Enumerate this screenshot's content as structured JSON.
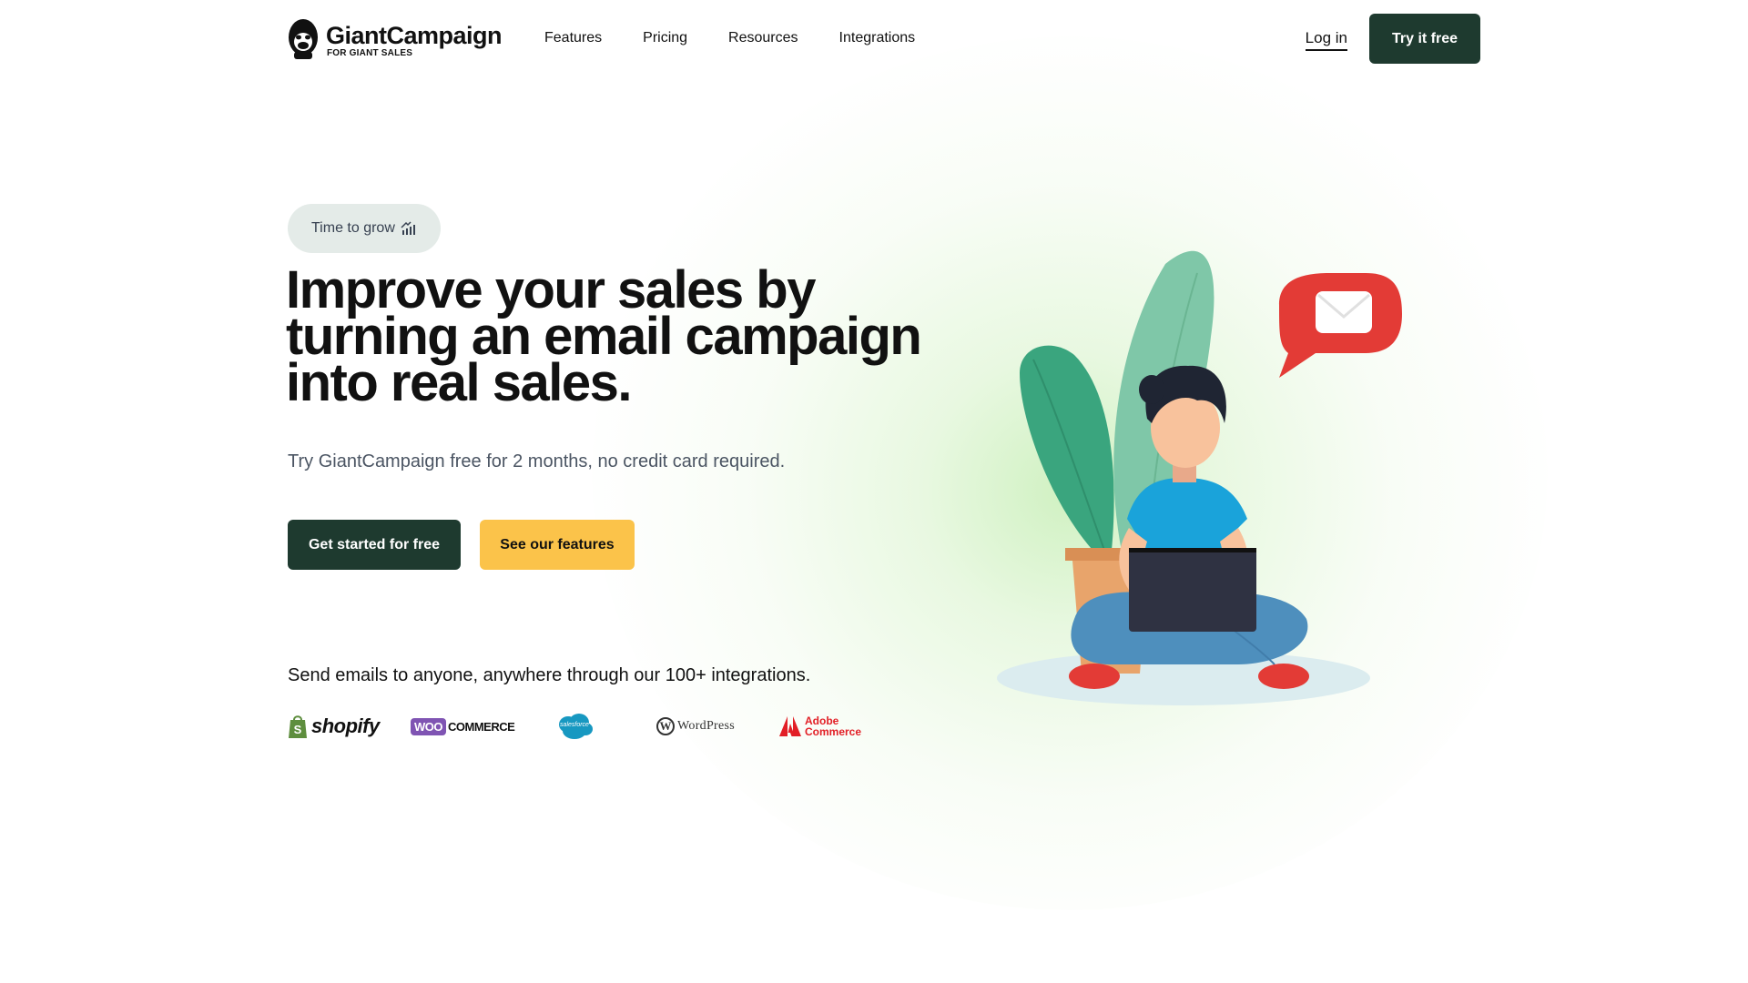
{
  "brand": {
    "name": "GiantCampaign",
    "tagline": "FOR GIANT SALES"
  },
  "nav": {
    "items": [
      {
        "label": "Features"
      },
      {
        "label": "Pricing"
      },
      {
        "label": "Resources"
      },
      {
        "label": "Integrations"
      }
    ],
    "login_label": "Log in",
    "try_label": "Try it free"
  },
  "hero": {
    "badge_text": "Time to grow",
    "badge_icon": "growth-chart-icon",
    "headline": "Improve your sales by turning an email campaign into real sales.",
    "subline": "Try GiantCampaign free for 2 months, no credit card required.",
    "primary_cta": "Get started for free",
    "secondary_cta": "See our features"
  },
  "integrations": {
    "text": "Send emails to anyone, anywhere through our 100+ integrations.",
    "logos": {
      "shopify": "shopify",
      "woo_badge": "WOO",
      "woo_text": "COMMERCE",
      "salesforce": "salesforce",
      "wordpress": "WordPress",
      "adobe_line1": "Adobe",
      "adobe_line2": "Commerce"
    }
  },
  "colors": {
    "primary": "#1e3a2f",
    "accent": "#fbc34a",
    "glow": "#d6f2c8"
  }
}
